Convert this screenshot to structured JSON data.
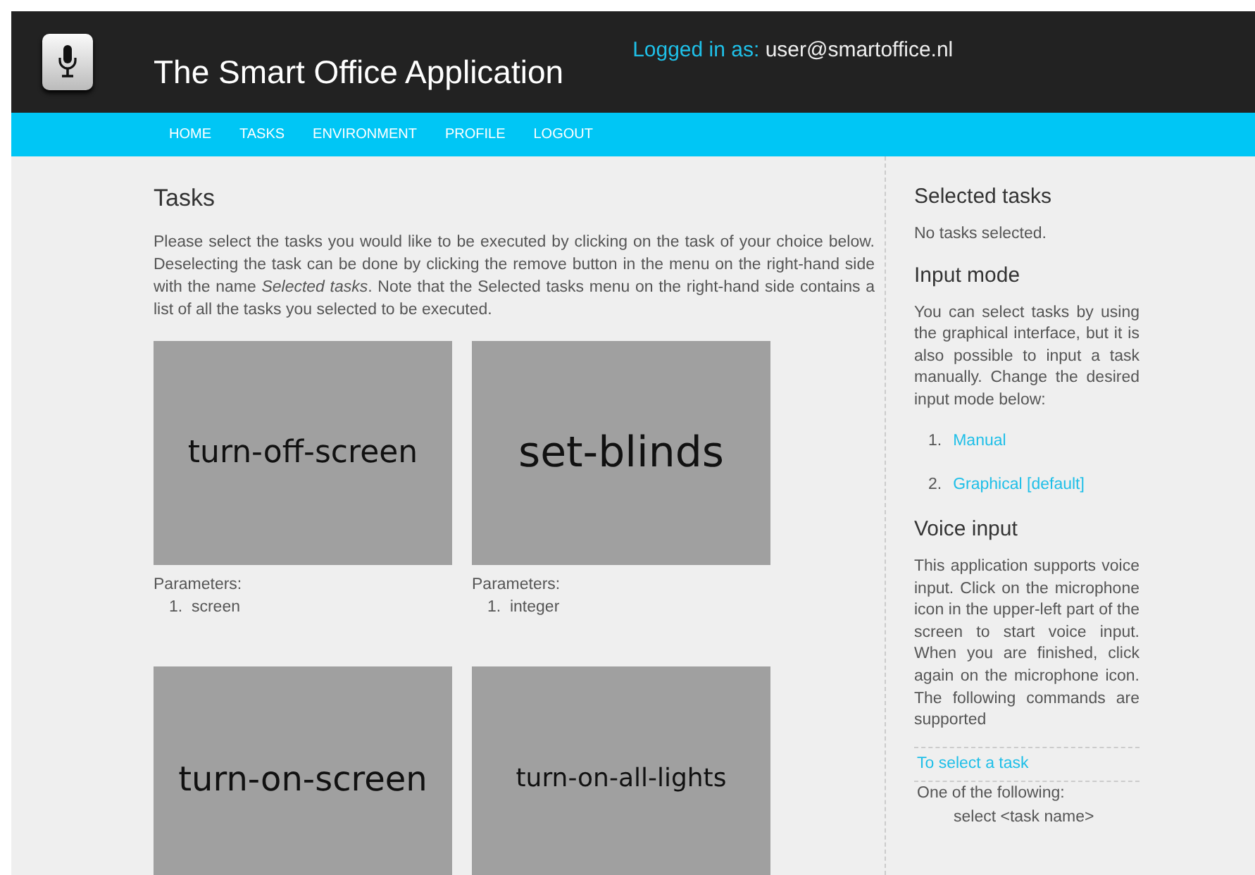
{
  "header": {
    "title": "The Smart Office Application",
    "login_label": "Logged in as:",
    "login_user": "user@smartoffice.nl"
  },
  "nav": [
    {
      "label": "HOME"
    },
    {
      "label": "TASKS"
    },
    {
      "label": "ENVIRONMENT"
    },
    {
      "label": "PROFILE"
    },
    {
      "label": "LOGOUT"
    }
  ],
  "main": {
    "heading": "Tasks",
    "intro": "Please select the tasks you would like to be executed by clicking on the task of your choice below. Deselecting the task can be done by clicking the remove button in the menu on the right-hand side with the name *Selected tasks*. Note that the Selected tasks menu on the right-hand side contains a list of all the tasks you selected to be executed.",
    "tasks": [
      {
        "name": "turn-off-screen",
        "parameters_label": "Parameters:",
        "parameters": [
          {
            "number": "1.",
            "text": "screen"
          }
        ]
      },
      {
        "name": "set-blinds",
        "parameters_label": "Parameters:",
        "parameters": [
          {
            "number": "1.",
            "text": "integer"
          }
        ]
      },
      {
        "name": "turn-on-screen"
      },
      {
        "name": "turn-on-all-lights"
      }
    ]
  },
  "sidebar": {
    "selected_heading": "Selected tasks",
    "selected_empty": "No tasks selected.",
    "input_heading": "Input mode",
    "input_text": "You can select tasks by using the graphical interface, but it is also possible to input a task manually. Change the desired input mode below:",
    "modes": [
      {
        "number": "1.",
        "label": "Manual"
      },
      {
        "number": "2.",
        "label": "Graphical [default]"
      }
    ],
    "voice_heading": "Voice input",
    "voice_text": "This application supports voice input. Click on the microphone icon in the upper-left part of the screen to start voice input. When you are finished, click again on the microphone icon. The following commands are supported",
    "command_title": "To select a task",
    "command_intro": "One of the following:",
    "command_syntax": "select <task name>"
  }
}
